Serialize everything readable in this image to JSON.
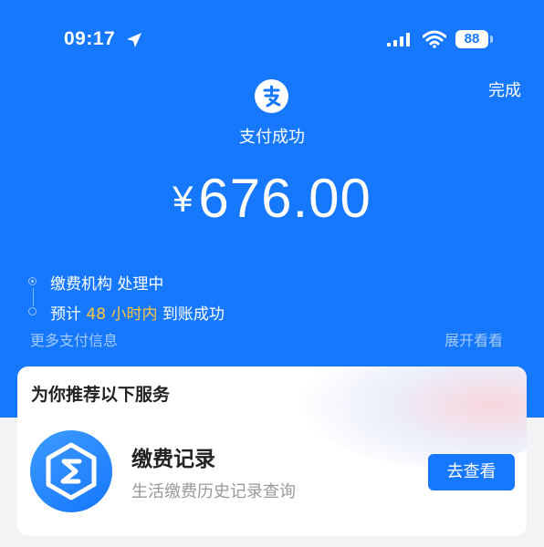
{
  "status_bar": {
    "time": "09:17",
    "battery": "88"
  },
  "header": {
    "done_label": "完成",
    "success_text": "支付成功"
  },
  "payment": {
    "currency": "¥",
    "amount": "676.00"
  },
  "progress": {
    "step1": "缴费机构 处理中",
    "step2_prefix": "预计 ",
    "step2_highlight": "48 小时内",
    "step2_suffix": " 到账成功"
  },
  "links": {
    "more_info": "更多支付信息",
    "expand": "展开看看"
  },
  "recommend": {
    "title": "为你推荐以下服务",
    "service_name": "缴费记录",
    "service_desc": "生活缴费历史记录查询",
    "view_button": "去查看"
  },
  "icons": {
    "location": "location-arrow-icon",
    "signal": "cellular-signal-icon",
    "wifi": "wifi-icon",
    "battery": "battery-icon",
    "logo": "alipay-logo-icon",
    "service": "payment-records-icon"
  },
  "colors": {
    "primary": "#1677ff",
    "highlight": "#ffc53d"
  }
}
